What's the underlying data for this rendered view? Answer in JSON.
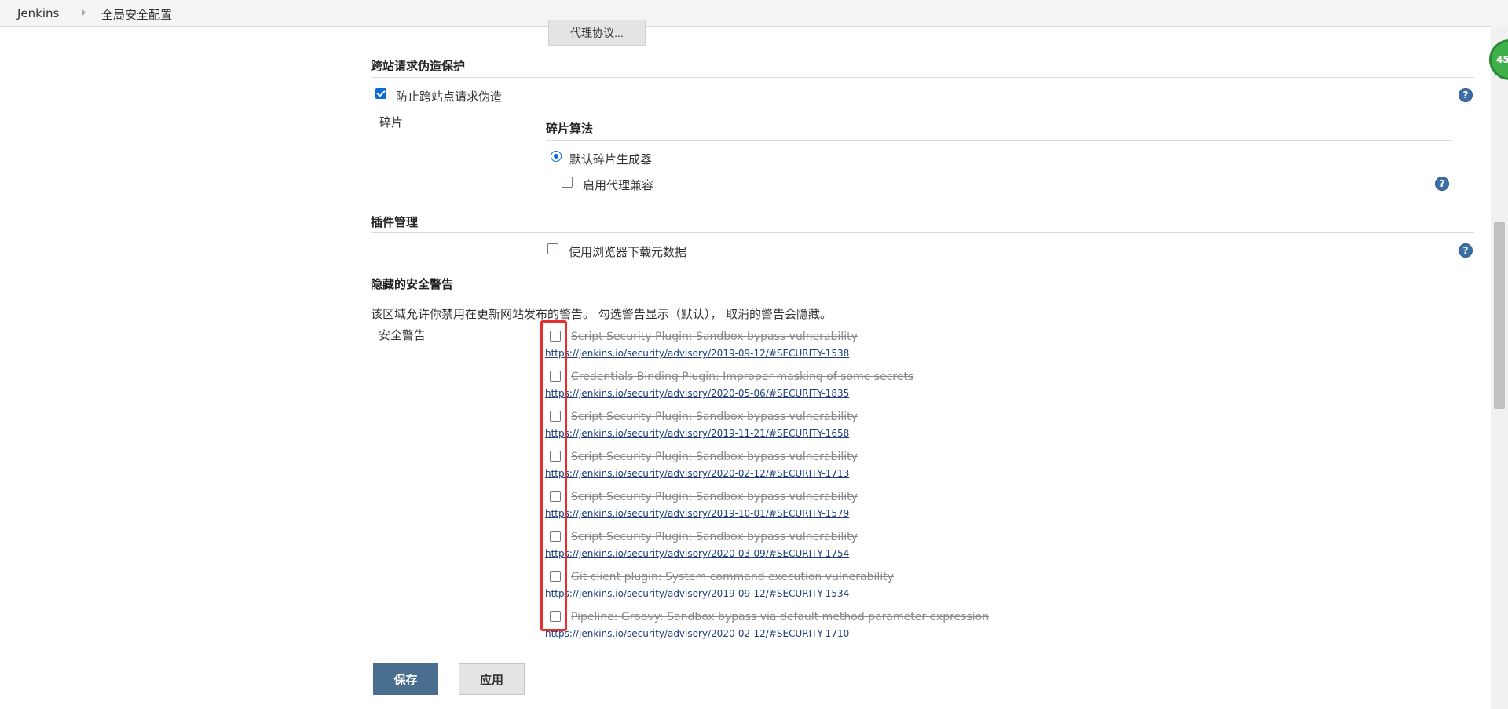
{
  "breadcrumb": {
    "root": "Jenkins",
    "current": "全局安全配置"
  },
  "proxy_button": "代理协议...",
  "csrf": {
    "title": "跨站请求伪造保护",
    "checkbox_label": "防止跨站点请求伪造",
    "checked": true,
    "crumb_label": "碎片",
    "algorithm_title": "碎片算法",
    "radio_label": "默认碎片生成器",
    "proxy_compat_label": "启用代理兼容"
  },
  "plugin_mgmt": {
    "title": "插件管理",
    "browser_download_label": "使用浏览器下载元数据"
  },
  "hidden_warnings": {
    "title": "隐藏的安全警告",
    "description": "该区域允许你禁用在更新网站发布的警告。 勾选警告显示（默认）， 取消的警告会隐藏。",
    "label": "安全警告",
    "items": [
      {
        "title": "Script Security Plugin: Sandbox bypass vulnerability",
        "url": "https://jenkins.io/security/advisory/2019-09-12/#SECURITY-1538"
      },
      {
        "title": "Credentials Binding Plugin: Improper masking of some secrets",
        "url": "https://jenkins.io/security/advisory/2020-05-06/#SECURITY-1835"
      },
      {
        "title": "Script Security Plugin: Sandbox bypass vulnerability",
        "url": "https://jenkins.io/security/advisory/2019-11-21/#SECURITY-1658"
      },
      {
        "title": "Script Security Plugin: Sandbox bypass vulnerability",
        "url": "https://jenkins.io/security/advisory/2020-02-12/#SECURITY-1713"
      },
      {
        "title": "Script Security Plugin: Sandbox bypass vulnerability",
        "url": "https://jenkins.io/security/advisory/2019-10-01/#SECURITY-1579"
      },
      {
        "title": "Script Security Plugin: Sandbox bypass vulnerability",
        "url": "https://jenkins.io/security/advisory/2020-03-09/#SECURITY-1754"
      },
      {
        "title": "Git client plugin: System command execution vulnerability",
        "url": "https://jenkins.io/security/advisory/2019-09-12/#SECURITY-1534"
      },
      {
        "title": "Pipeline: Groovy: Sandbox bypass via default method parameter expression",
        "url": "https://jenkins.io/security/advisory/2020-02-12/#SECURITY-1710"
      }
    ]
  },
  "buttons": {
    "save": "保存",
    "apply": "应用"
  },
  "help_icon_text": "?",
  "badge_text": "45",
  "colors": {
    "highlight": "#e53030",
    "save_button": "#4a6f8e",
    "accent": "#0a6dd8"
  }
}
